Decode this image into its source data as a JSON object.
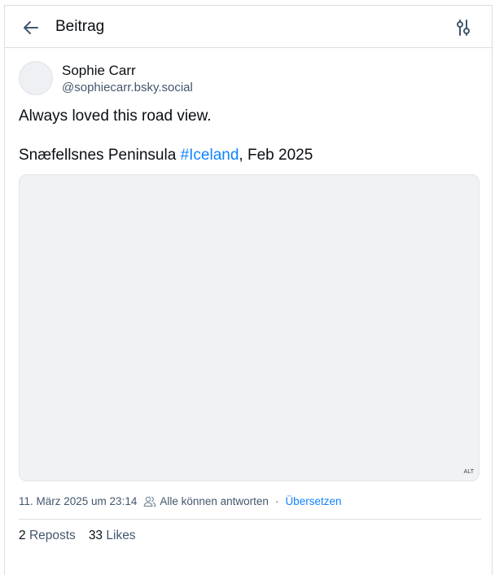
{
  "header": {
    "title": "Beitrag"
  },
  "post": {
    "author": {
      "display_name": "Sophie Carr",
      "handle": "@sophiecarr.bsky.social"
    },
    "text_line1": "Always loved this road view.",
    "text_line2_prefix": "Snæfellsnes Peninsula ",
    "hashtag": "#Iceland",
    "text_line2_suffix": ", Feb 2025",
    "image": {
      "alt_badge": "ALT"
    },
    "meta": {
      "timestamp": "11. März 2025 um 23:14",
      "reply_setting": "Alle können antworten",
      "separator": "·",
      "translate_label": "Übersetzen"
    },
    "stats": {
      "reposts_count": "2",
      "reposts_label": "Reposts",
      "likes_count": "33",
      "likes_label": "Likes"
    }
  },
  "colors": {
    "link": "#1083fe",
    "muted_text": "#42576c",
    "border": "#d9dee4",
    "image_placeholder": "#f1f2f4"
  },
  "icons": {
    "back": "arrow-left-icon",
    "settings": "sliders-icon",
    "reply_setting": "people-icon"
  }
}
